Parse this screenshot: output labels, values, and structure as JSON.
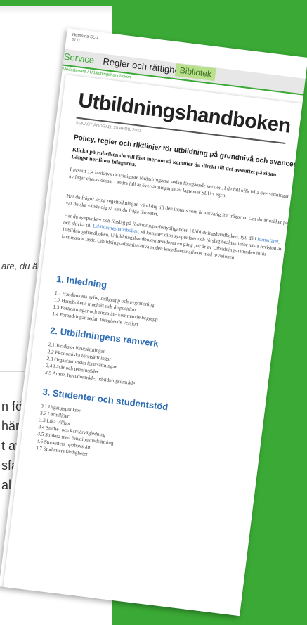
{
  "site": {
    "logo_line1": "Hemsida SLU",
    "logo_line2": "SLU"
  },
  "nav": {
    "service": "Service",
    "rules": "Regler och rättigheter",
    "library": "Bibliotek"
  },
  "breadcrumb": "Medarbetare / Utbildningshandboken",
  "doc": {
    "title": "Utbildningshandboken",
    "updated": "SENAST ÄNDRAD: 28 APRIL 2021",
    "subtitle": "Policy, regler och riktlinjer för utbildning på grundnivå och avancerad nivå",
    "intro_bold": "Klicka på rubriken du vill läsa mer om så kommer du direkt till det avsnittet på sidan. Längst ner finns bilagorna.",
    "para1": "I avsnitt 1.4 beskrivs de viktigaste förändringarna sedan föregående version. I de fall officiella översättningar av lagar citeras dessa, i andra fall är översättningarna av lagtexter SLU:s egen.",
    "para2": "Har du frågor kring regeltolkningar, vänd dig till den instans som är ansvarig för frågorna. Om du är osäker på var du ska vända dig så kan du fråga lärosätet.",
    "para3_a": "Har du synpunkter och förslag på förändringar/förtydliganden i Utbildningshandboken, fyll då i ",
    "para3_link": "formuläret",
    "para3_b": ", och skicka till ",
    "para3_link2": "Utbildningshandboken",
    "para3_c": ", så kommer dina synpunkter och förslag beaktas inför nästa revision av Utbildningshandboken. Utbildningshandboken revideras en gång per år av Utbildningsnämnden inför kommande läsår. Utbildningsadministrativa noden koordinerar arbetet med revisionen."
  },
  "sections": [
    {
      "title": "1. Inledning",
      "items": [
        "1.1 Handbokens syfte, målgrupp och avgränsning",
        "1.2 Handbokens innehåll och disposition",
        "1.3 Förkortningar och andra återkommande begrepp",
        "1.4 Förändringar sedan föregående version"
      ]
    },
    {
      "title": "2. Utbildningens ramverk",
      "items": [
        "2.1 Juridiska förutsättningar",
        "2.2 Ekonomiska förutsättningar",
        "2.3 Organisatoriska förutsättningar",
        "2.4 Läsår och terminstider",
        "2.5 Ämne, huvudområde, utbildningsområde"
      ]
    },
    {
      "title": "3. Studenter och studentstöd",
      "items": [
        "3.1 Utgångspunkter",
        "3.2 Lärmiljöer",
        "3.3 Lika villkor",
        "3.4 Studie- och karriärvägledning",
        "3.5 Studera med funktionsnedsättning",
        "3.6 Studenters upphovsrätt",
        "3.7 Studenters färdigheter"
      ]
    }
  ],
  "background": {
    "italic_text": "are, du är",
    "lines": [
      "n för v",
      "härom",
      "t av",
      "sfall",
      "alas"
    ]
  },
  "colors": {
    "brand_green": "#3aa935",
    "link_blue": "#2e6db4",
    "nav_lib_bg": "#b8e08d"
  }
}
